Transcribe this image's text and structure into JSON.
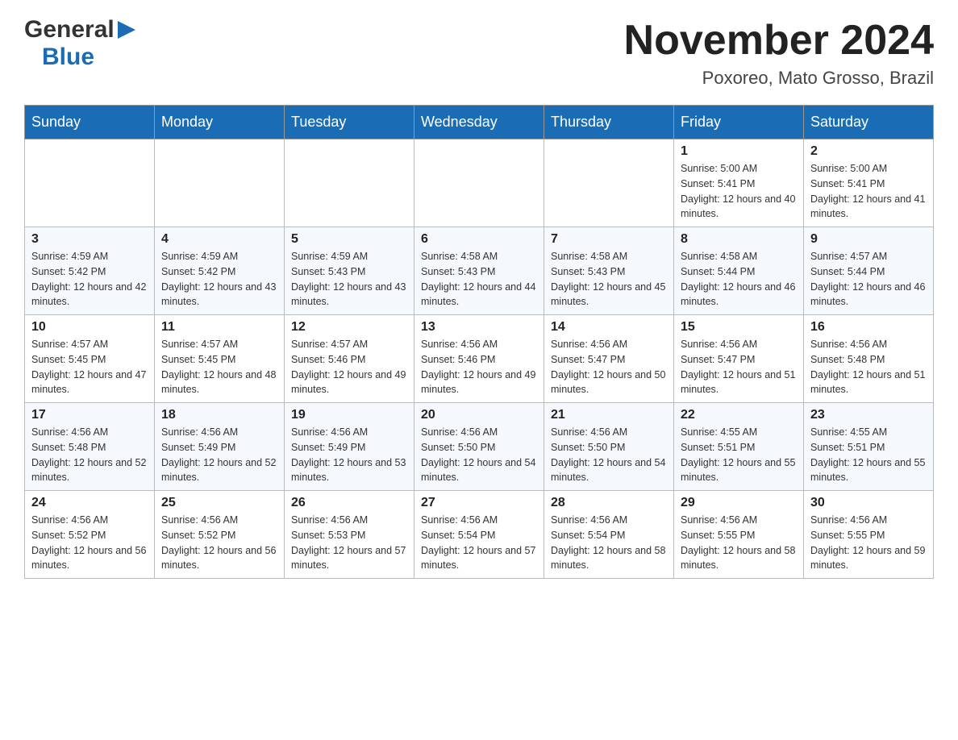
{
  "header": {
    "logo": {
      "general": "General",
      "blue": "Blue"
    },
    "title": "November 2024",
    "location": "Poxoreo, Mato Grosso, Brazil"
  },
  "weekdays": [
    "Sunday",
    "Monday",
    "Tuesday",
    "Wednesday",
    "Thursday",
    "Friday",
    "Saturday"
  ],
  "weeks": [
    [
      {
        "day": "",
        "sunrise": "",
        "sunset": "",
        "daylight": ""
      },
      {
        "day": "",
        "sunrise": "",
        "sunset": "",
        "daylight": ""
      },
      {
        "day": "",
        "sunrise": "",
        "sunset": "",
        "daylight": ""
      },
      {
        "day": "",
        "sunrise": "",
        "sunset": "",
        "daylight": ""
      },
      {
        "day": "",
        "sunrise": "",
        "sunset": "",
        "daylight": ""
      },
      {
        "day": "1",
        "sunrise": "Sunrise: 5:00 AM",
        "sunset": "Sunset: 5:41 PM",
        "daylight": "Daylight: 12 hours and 40 minutes."
      },
      {
        "day": "2",
        "sunrise": "Sunrise: 5:00 AM",
        "sunset": "Sunset: 5:41 PM",
        "daylight": "Daylight: 12 hours and 41 minutes."
      }
    ],
    [
      {
        "day": "3",
        "sunrise": "Sunrise: 4:59 AM",
        "sunset": "Sunset: 5:42 PM",
        "daylight": "Daylight: 12 hours and 42 minutes."
      },
      {
        "day": "4",
        "sunrise": "Sunrise: 4:59 AM",
        "sunset": "Sunset: 5:42 PM",
        "daylight": "Daylight: 12 hours and 43 minutes."
      },
      {
        "day": "5",
        "sunrise": "Sunrise: 4:59 AM",
        "sunset": "Sunset: 5:43 PM",
        "daylight": "Daylight: 12 hours and 43 minutes."
      },
      {
        "day": "6",
        "sunrise": "Sunrise: 4:58 AM",
        "sunset": "Sunset: 5:43 PM",
        "daylight": "Daylight: 12 hours and 44 minutes."
      },
      {
        "day": "7",
        "sunrise": "Sunrise: 4:58 AM",
        "sunset": "Sunset: 5:43 PM",
        "daylight": "Daylight: 12 hours and 45 minutes."
      },
      {
        "day": "8",
        "sunrise": "Sunrise: 4:58 AM",
        "sunset": "Sunset: 5:44 PM",
        "daylight": "Daylight: 12 hours and 46 minutes."
      },
      {
        "day": "9",
        "sunrise": "Sunrise: 4:57 AM",
        "sunset": "Sunset: 5:44 PM",
        "daylight": "Daylight: 12 hours and 46 minutes."
      }
    ],
    [
      {
        "day": "10",
        "sunrise": "Sunrise: 4:57 AM",
        "sunset": "Sunset: 5:45 PM",
        "daylight": "Daylight: 12 hours and 47 minutes."
      },
      {
        "day": "11",
        "sunrise": "Sunrise: 4:57 AM",
        "sunset": "Sunset: 5:45 PM",
        "daylight": "Daylight: 12 hours and 48 minutes."
      },
      {
        "day": "12",
        "sunrise": "Sunrise: 4:57 AM",
        "sunset": "Sunset: 5:46 PM",
        "daylight": "Daylight: 12 hours and 49 minutes."
      },
      {
        "day": "13",
        "sunrise": "Sunrise: 4:56 AM",
        "sunset": "Sunset: 5:46 PM",
        "daylight": "Daylight: 12 hours and 49 minutes."
      },
      {
        "day": "14",
        "sunrise": "Sunrise: 4:56 AM",
        "sunset": "Sunset: 5:47 PM",
        "daylight": "Daylight: 12 hours and 50 minutes."
      },
      {
        "day": "15",
        "sunrise": "Sunrise: 4:56 AM",
        "sunset": "Sunset: 5:47 PM",
        "daylight": "Daylight: 12 hours and 51 minutes."
      },
      {
        "day": "16",
        "sunrise": "Sunrise: 4:56 AM",
        "sunset": "Sunset: 5:48 PM",
        "daylight": "Daylight: 12 hours and 51 minutes."
      }
    ],
    [
      {
        "day": "17",
        "sunrise": "Sunrise: 4:56 AM",
        "sunset": "Sunset: 5:48 PM",
        "daylight": "Daylight: 12 hours and 52 minutes."
      },
      {
        "day": "18",
        "sunrise": "Sunrise: 4:56 AM",
        "sunset": "Sunset: 5:49 PM",
        "daylight": "Daylight: 12 hours and 52 minutes."
      },
      {
        "day": "19",
        "sunrise": "Sunrise: 4:56 AM",
        "sunset": "Sunset: 5:49 PM",
        "daylight": "Daylight: 12 hours and 53 minutes."
      },
      {
        "day": "20",
        "sunrise": "Sunrise: 4:56 AM",
        "sunset": "Sunset: 5:50 PM",
        "daylight": "Daylight: 12 hours and 54 minutes."
      },
      {
        "day": "21",
        "sunrise": "Sunrise: 4:56 AM",
        "sunset": "Sunset: 5:50 PM",
        "daylight": "Daylight: 12 hours and 54 minutes."
      },
      {
        "day": "22",
        "sunrise": "Sunrise: 4:55 AM",
        "sunset": "Sunset: 5:51 PM",
        "daylight": "Daylight: 12 hours and 55 minutes."
      },
      {
        "day": "23",
        "sunrise": "Sunrise: 4:55 AM",
        "sunset": "Sunset: 5:51 PM",
        "daylight": "Daylight: 12 hours and 55 minutes."
      }
    ],
    [
      {
        "day": "24",
        "sunrise": "Sunrise: 4:56 AM",
        "sunset": "Sunset: 5:52 PM",
        "daylight": "Daylight: 12 hours and 56 minutes."
      },
      {
        "day": "25",
        "sunrise": "Sunrise: 4:56 AM",
        "sunset": "Sunset: 5:52 PM",
        "daylight": "Daylight: 12 hours and 56 minutes."
      },
      {
        "day": "26",
        "sunrise": "Sunrise: 4:56 AM",
        "sunset": "Sunset: 5:53 PM",
        "daylight": "Daylight: 12 hours and 57 minutes."
      },
      {
        "day": "27",
        "sunrise": "Sunrise: 4:56 AM",
        "sunset": "Sunset: 5:54 PM",
        "daylight": "Daylight: 12 hours and 57 minutes."
      },
      {
        "day": "28",
        "sunrise": "Sunrise: 4:56 AM",
        "sunset": "Sunset: 5:54 PM",
        "daylight": "Daylight: 12 hours and 58 minutes."
      },
      {
        "day": "29",
        "sunrise": "Sunrise: 4:56 AM",
        "sunset": "Sunset: 5:55 PM",
        "daylight": "Daylight: 12 hours and 58 minutes."
      },
      {
        "day": "30",
        "sunrise": "Sunrise: 4:56 AM",
        "sunset": "Sunset: 5:55 PM",
        "daylight": "Daylight: 12 hours and 59 minutes."
      }
    ]
  ]
}
